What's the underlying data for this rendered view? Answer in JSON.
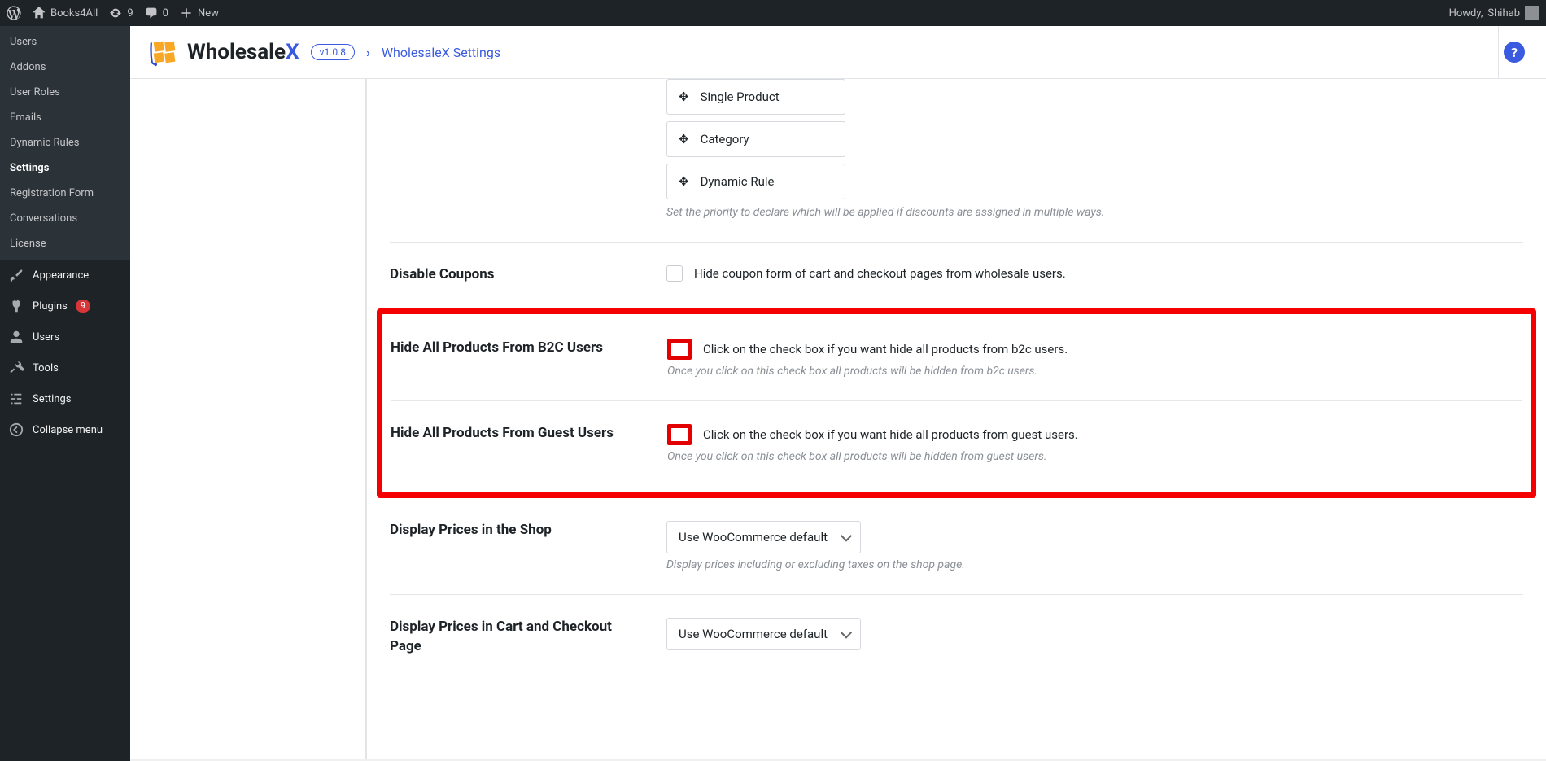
{
  "adminbar": {
    "site_name": "Books4All",
    "updates_count": "9",
    "comments_count": "0",
    "new_label": "New",
    "howdy_prefix": "Howdy, ",
    "user_name": "Shihab"
  },
  "sidebar": {
    "submenu": [
      {
        "label": "Users"
      },
      {
        "label": "Addons"
      },
      {
        "label": "User Roles"
      },
      {
        "label": "Emails"
      },
      {
        "label": "Dynamic Rules"
      },
      {
        "label": "Settings"
      },
      {
        "label": "Registration Form"
      },
      {
        "label": "Conversations"
      },
      {
        "label": "License"
      }
    ],
    "top": {
      "appearance": "Appearance",
      "plugins": "Plugins",
      "plugins_badge": "9",
      "users": "Users",
      "tools": "Tools",
      "settings": "Settings",
      "collapse": "Collapse menu"
    }
  },
  "header": {
    "brand_a": "Wholesale",
    "brand_b": "X",
    "version": "v1.0.8",
    "crumb": "WholesaleX Settings",
    "help_glyph": "?"
  },
  "settings": {
    "priority_items": [
      "Single Product",
      "Category",
      "Dynamic Rule"
    ],
    "priority_hint": "Set the priority to declare which will be applied if discounts are assigned in multiple ways.",
    "disable_coupons_label": "Disable Coupons",
    "disable_coupons_text": "Hide coupon form of cart and checkout pages from wholesale users.",
    "hide_b2c_label": "Hide All Products From B2C Users",
    "hide_b2c_text": "Click on the check box if you want hide all products from b2c users.",
    "hide_b2c_hint": "Once you click on this check box all products will be hidden from b2c users.",
    "hide_guest_label": "Hide All Products From Guest Users",
    "hide_guest_text": "Click on the check box if you want hide all products from guest users.",
    "hide_guest_hint": "Once you click on this check box all products will be hidden from guest users.",
    "prices_shop_label": "Display Prices in the Shop",
    "prices_shop_value": "Use WooCommerce default",
    "prices_shop_hint": "Display prices including or excluding taxes on the shop page.",
    "prices_cart_label": "Display Prices in Cart and Checkout Page",
    "prices_cart_value": "Use WooCommerce default"
  }
}
